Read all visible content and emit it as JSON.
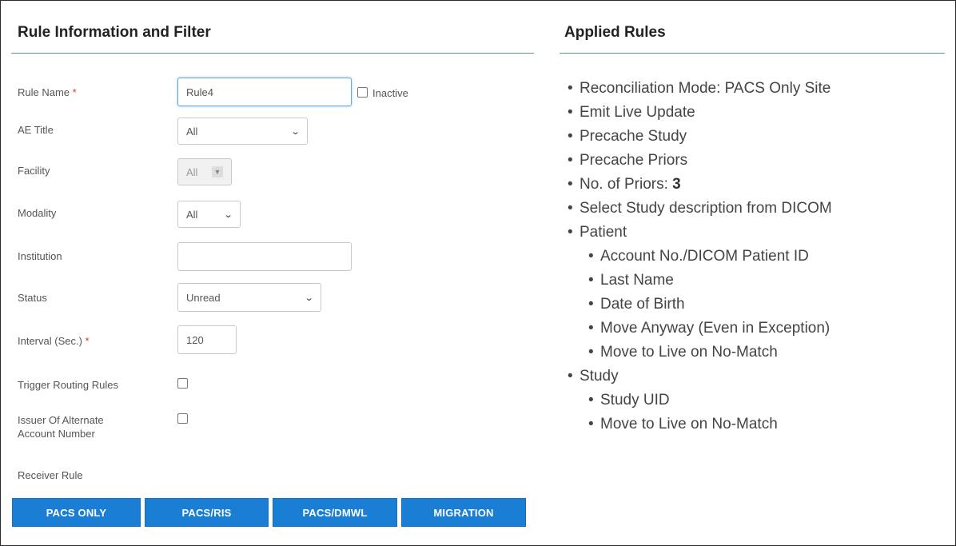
{
  "left_panel": {
    "title": "Rule Information and Filter",
    "fields": {
      "rule_name": {
        "label": "Rule Name",
        "required": "*",
        "value": "Rule4"
      },
      "inactive": {
        "label": "Inactive"
      },
      "ae_title": {
        "label": "AE Title",
        "value": "All"
      },
      "facility": {
        "label": "Facility",
        "value": "All"
      },
      "modality": {
        "label": "Modality",
        "value": "All"
      },
      "institution": {
        "label": "Institution",
        "value": ""
      },
      "status": {
        "label": "Status",
        "value": "Unread"
      },
      "interval": {
        "label": "Interval (Sec.)",
        "required": "*",
        "value": "120"
      },
      "trigger_routing": {
        "label": "Trigger Routing Rules"
      },
      "issuer": {
        "label_line1": "Issuer Of Alternate",
        "label_line2": "Account Number"
      },
      "receiver_rule": {
        "label": "Receiver Rule"
      }
    },
    "buttons": [
      "PACS ONLY",
      "PACS/RIS",
      "PACS/DMWL",
      "MIGRATION"
    ]
  },
  "right_panel": {
    "title": "Applied Rules",
    "items": [
      {
        "text": "Reconciliation Mode: PACS Only Site"
      },
      {
        "text": "Emit Live Update"
      },
      {
        "text": "Precache Study"
      },
      {
        "text": "Precache Priors"
      },
      {
        "text": "No. of Priors: ",
        "value": "3"
      },
      {
        "text": "Select Study description from DICOM"
      },
      {
        "text": "Patient"
      },
      {
        "text": "Account No./DICOM Patient ID",
        "sub": true
      },
      {
        "text": "Last Name",
        "sub": true
      },
      {
        "text": "Date of Birth",
        "sub": true
      },
      {
        "text": "Move Anyway (Even in Exception)",
        "sub": true
      },
      {
        "text": "Move to Live on No-Match",
        "sub": true
      },
      {
        "text": "Study"
      },
      {
        "text": "Study UID",
        "sub": true
      },
      {
        "text": "Move to Live on No-Match",
        "sub": true
      }
    ]
  },
  "colors": {
    "accent": "#1a7fd4",
    "rule_line": "#5b8fb0",
    "required": "#dd3333"
  }
}
